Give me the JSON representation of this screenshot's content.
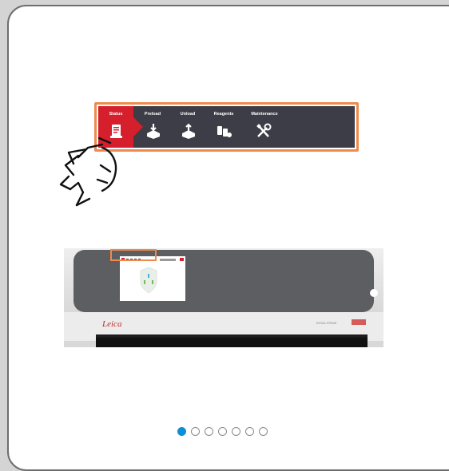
{
  "nav": {
    "items": [
      {
        "label": "Status",
        "icon": "status-icon",
        "active": true
      },
      {
        "label": "Preload",
        "icon": "preload-icon",
        "active": false
      },
      {
        "label": "Unload",
        "icon": "unload-icon",
        "active": false
      },
      {
        "label": "Reagents",
        "icon": "reagents-icon",
        "active": false
      },
      {
        "label": "Maintenance",
        "icon": "maintenance-icon",
        "active": false
      }
    ]
  },
  "instrument": {
    "brand_logo": "Leica",
    "model_label": "BOND-PRIME"
  },
  "pager": {
    "total": 7,
    "active_index": 0
  },
  "colors": {
    "accent_red": "#d51f2c",
    "nav_background": "#3c3d47",
    "highlight_orange": "#ef8a4c",
    "pager_active": "#0a90d8"
  }
}
